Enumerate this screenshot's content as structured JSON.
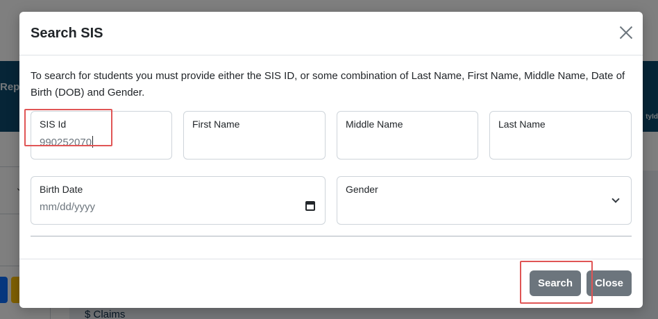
{
  "background": {
    "tab_label": "Repo",
    "right_label": "tyId",
    "claims_label": "$ Claims"
  },
  "modal": {
    "title": "Search SIS",
    "description": "To search for students you must provide either the SIS ID, or some combination of Last Name, First Name, Middle Name, Date of Birth (DOB) and Gender.",
    "fields": {
      "sis_id": {
        "label": "SIS Id",
        "value": "990252070"
      },
      "first_name": {
        "label": "First Name",
        "value": ""
      },
      "middle_name": {
        "label": "Middle Name",
        "value": ""
      },
      "last_name": {
        "label": "Last Name",
        "value": ""
      },
      "birth_date": {
        "label": "Birth Date",
        "placeholder": "mm/dd/yyyy"
      },
      "gender": {
        "label": "Gender",
        "value": ""
      }
    },
    "buttons": {
      "search": "Search",
      "close": "Close"
    }
  },
  "colors": {
    "header_band": "#0c4a6e",
    "button_gray": "#6c757d",
    "highlight": "#e05555"
  },
  "icons": [
    "close-icon",
    "calendar-icon",
    "chevron-down-icon"
  ]
}
